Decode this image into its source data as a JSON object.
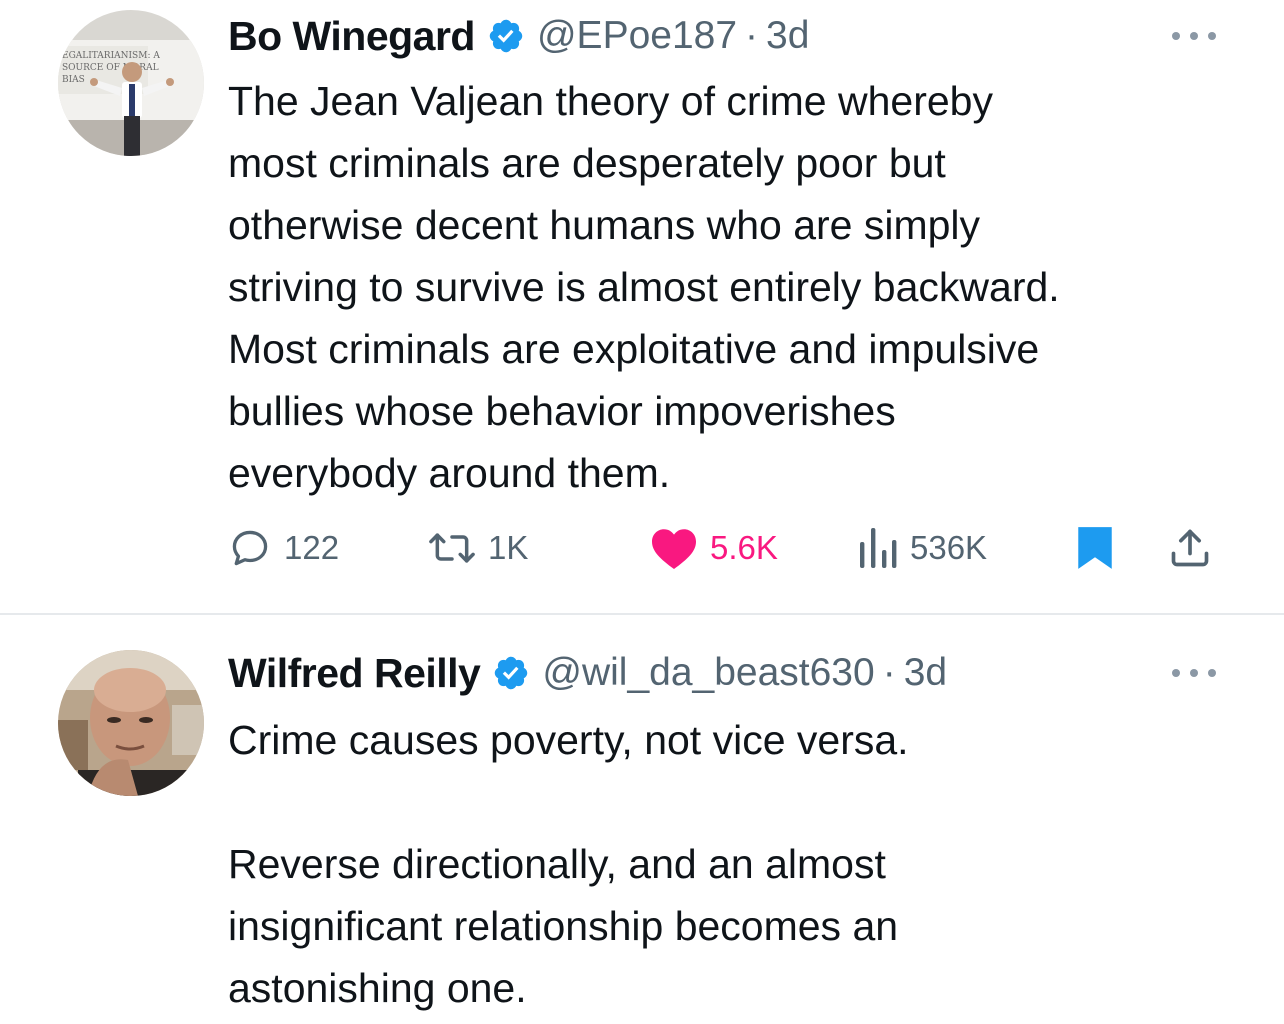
{
  "tweets": [
    {
      "author_name": "Bo Winegard",
      "handle": "@EPoe187",
      "separator": "·",
      "time": "3d",
      "text": "The Jean Valjean theory of crime whereby\nmost criminals are desperately poor but\notherwise decent humans who are simply\nstriving to survive is almost entirely backward.\nMost criminals are exploitative and impulsive\nbullies whose behavior impoverishes\neverybody around them.",
      "avatar_sign_text": "EGALITARIANISM: A SOURCE OF MORAL BIAS",
      "stats": {
        "replies": "122",
        "retweets": "1K",
        "likes": "5.6K",
        "views": "536K"
      },
      "liked": true,
      "bookmarked": true
    },
    {
      "author_name": "Wilfred Reilly",
      "handle": "@wil_da_beast630",
      "separator": "·",
      "time": "3d",
      "text": "Crime causes poverty, not vice versa.\n\nReverse directionally, and an almost\ninsignificant relationship becomes an\nastonishing one."
    }
  ],
  "colors": {
    "text": "#0f1419",
    "secondary": "#536471",
    "verified_blue": "#1d9bf0",
    "like_pink": "#f91880",
    "divider": "#e6e9ec"
  },
  "icons": {
    "reply": "speech-bubble",
    "retweet": "retweet-arrows",
    "like": "heart-filled",
    "views": "bar-chart",
    "bookmark": "bookmark-filled",
    "share": "upload-arrow",
    "more": "three-dots",
    "verified": "verified-badge"
  }
}
